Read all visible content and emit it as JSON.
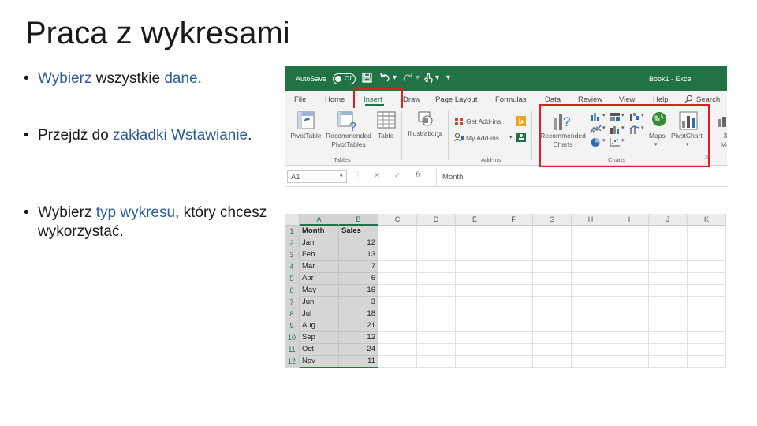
{
  "slide": {
    "title": "Praca z wykresami",
    "bullets": [
      {
        "bullet": "•",
        "parts": [
          {
            "t": "Wybierz",
            "hl": true
          },
          {
            "t": " wszystkie ",
            "hl": false
          },
          {
            "t": "dane",
            "hl": true
          },
          {
            "t": ".",
            "hl": false
          }
        ]
      },
      {
        "bullet": "•",
        "parts": [
          {
            "t": "Przejdź do ",
            "hl": false
          },
          {
            "t": "zakładki",
            "hl": true
          },
          {
            "t": " ",
            "hl": false
          },
          {
            "t": "Wstawianie",
            "hl": true
          },
          {
            "t": ".",
            "hl": false
          }
        ]
      },
      {
        "bullet": "•",
        "parts": [
          {
            "t": "Wybierz ",
            "hl": false
          },
          {
            "t": "typ wykresu",
            "hl": true
          },
          {
            "t": ", który chcesz wykorzystać.",
            "hl": false
          }
        ]
      }
    ],
    "highlight_color": "#2e5b9a"
  },
  "excel": {
    "autosave_label": "AutoSave",
    "autosave_state": "Off",
    "book_title": "Book1 - Excel",
    "tabs": [
      "File",
      "Home",
      "Insert",
      "Draw",
      "Page Layout",
      "Formulas",
      "Data",
      "Review",
      "View",
      "Help",
      "Search"
    ],
    "active_tab": "Insert",
    "ribbon": {
      "pivottable": "PivotTable",
      "recommended_pivot": "Recommended",
      "recommended_pivot2": "PivotTables",
      "table": "Table",
      "illustrations": "Illustrations",
      "get_addins": "Get Add-ins",
      "my_addins": "My Add-ins",
      "recommended_charts": "Recommended",
      "recommended_charts2": "Charts",
      "maps": "Maps",
      "pivotchart": "PivotChart",
      "cut1": "3",
      "cut2": "Ma",
      "group_tables": "Tables",
      "group_addins": "Add-ins",
      "group_charts": "Charts"
    },
    "name_box": "A1",
    "formula_value": "Month",
    "fx": "fx",
    "columns": [
      "A",
      "B",
      "C",
      "D",
      "E",
      "F",
      "G",
      "H",
      "I",
      "J",
      "K"
    ],
    "rows": [
      {
        "n": "1",
        "a": "Month",
        "b": "Sales"
      },
      {
        "n": "2",
        "a": "Jan",
        "b": "12"
      },
      {
        "n": "3",
        "a": "Feb",
        "b": "13"
      },
      {
        "n": "4",
        "a": "Mar",
        "b": "7"
      },
      {
        "n": "5",
        "a": "Apr",
        "b": "6"
      },
      {
        "n": "6",
        "a": "May",
        "b": "16"
      },
      {
        "n": "7",
        "a": "Jun",
        "b": "3"
      },
      {
        "n": "8",
        "a": "Jul",
        "b": "18"
      },
      {
        "n": "9",
        "a": "Aug",
        "b": "21"
      },
      {
        "n": "10",
        "a": "Sep",
        "b": "12"
      },
      {
        "n": "11",
        "a": "Oct",
        "b": "24"
      },
      {
        "n": "12",
        "a": "Nov",
        "b": "11"
      }
    ],
    "accent_color": "#217346",
    "highlight_box_color": "#e02020"
  }
}
